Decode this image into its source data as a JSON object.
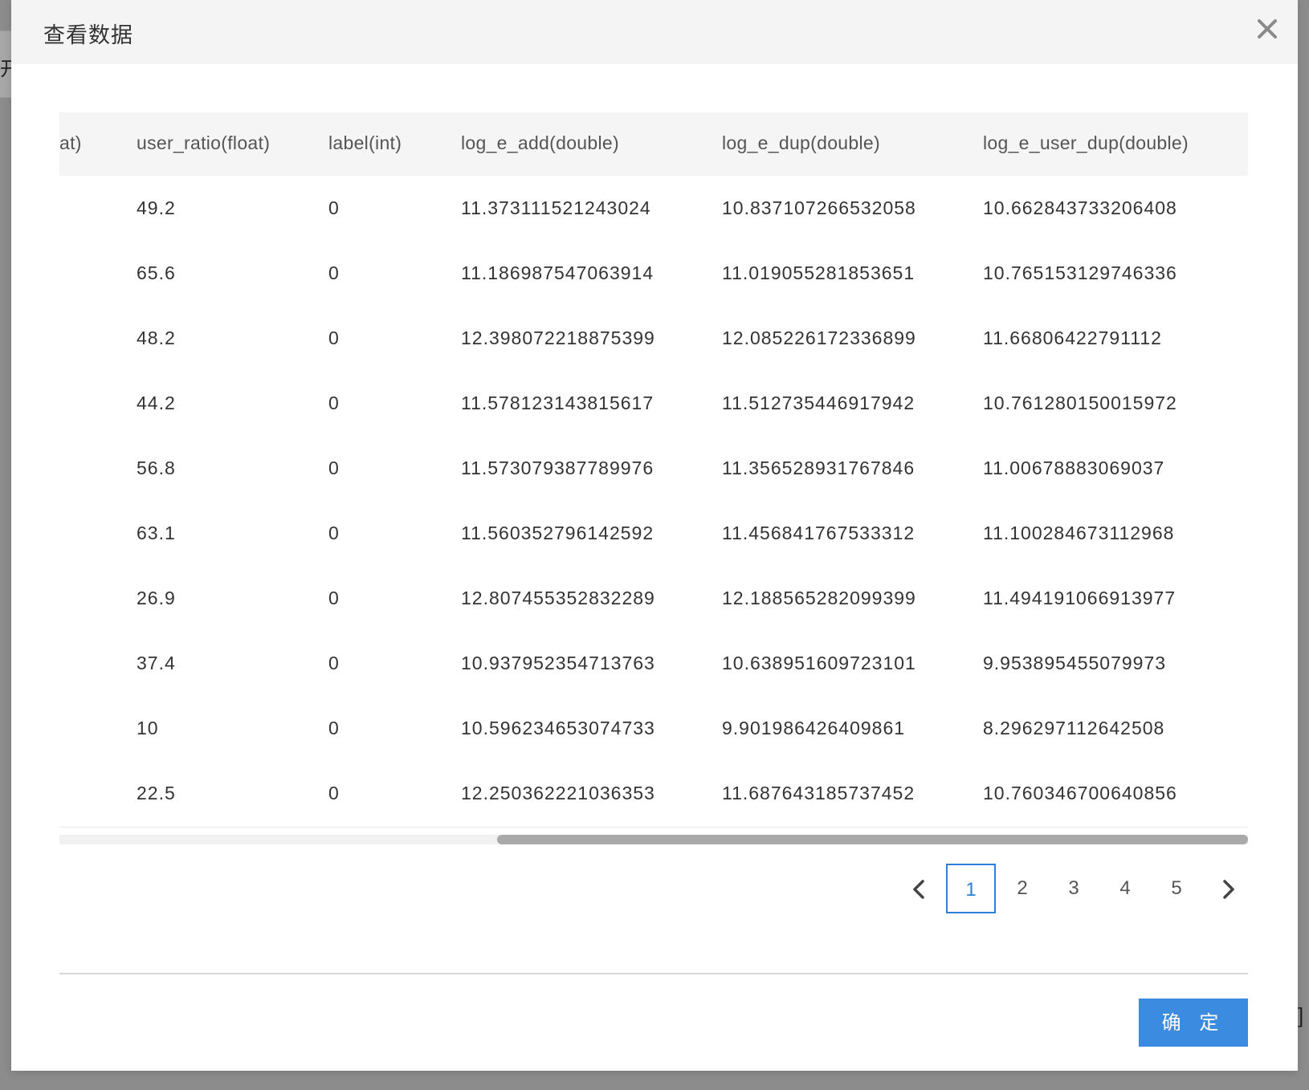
{
  "background": {
    "partial_text": "开",
    "right_glyph": "]"
  },
  "dialog": {
    "title": "查看数据",
    "confirm_label": "确 定"
  },
  "table": {
    "columns": [
      "at)",
      "user_ratio(float)",
      "label(int)",
      "log_e_add(double)",
      "log_e_dup(double)",
      "log_e_user_dup(double)"
    ],
    "rows": [
      [
        "",
        "49.2",
        "0",
        "11.373111521243024",
        "10.837107266532058",
        "10.662843733206408"
      ],
      [
        "",
        "65.6",
        "0",
        "11.186987547063914",
        "11.019055281853651",
        "10.765153129746336"
      ],
      [
        "",
        "48.2",
        "0",
        "12.398072218875399",
        "12.085226172336899",
        "11.66806422791112"
      ],
      [
        "",
        "44.2",
        "0",
        "11.578123143815617",
        "11.512735446917942",
        "10.761280150015972"
      ],
      [
        "",
        "56.8",
        "0",
        "11.573079387789976",
        "11.356528931767846",
        "11.00678883069037"
      ],
      [
        "",
        "63.1",
        "0",
        "11.560352796142592",
        "11.456841767533312",
        "11.100284673112968"
      ],
      [
        "",
        "26.9",
        "0",
        "12.807455352832289",
        "12.188565282099399",
        "11.494191066913977"
      ],
      [
        "",
        "37.4",
        "0",
        "10.937952354713763",
        "10.638951609723101",
        "9.953895455079973"
      ],
      [
        "",
        "10",
        "0",
        "10.596234653074733",
        "9.901986426409861",
        "8.296297112642508"
      ],
      [
        "",
        "22.5",
        "0",
        "12.250362221036353",
        "11.687643185737452",
        "10.760346700640856"
      ]
    ],
    "horizontal_scroll_position": 1.0
  },
  "pagination": {
    "pages": [
      "1",
      "2",
      "3",
      "4",
      "5"
    ],
    "current": "1",
    "prev_icon": "chevron-left-icon",
    "next_icon": "chevron-right-icon"
  },
  "colors": {
    "accent": "#3b8be0",
    "active_page": "#2f7fd9",
    "header_bg": "#f4f4f4"
  }
}
